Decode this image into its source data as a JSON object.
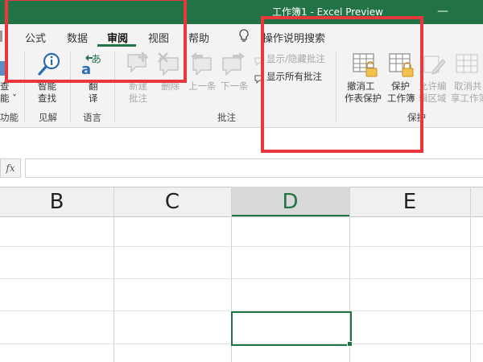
{
  "window": {
    "title": "工作簿1  -  Excel Preview",
    "minimize_glyph": "—"
  },
  "tabs": [
    {
      "label": "公式",
      "active": false
    },
    {
      "label": "数据",
      "active": false
    },
    {
      "label": "审阅",
      "active": true
    },
    {
      "label": "视图",
      "active": false
    },
    {
      "label": "帮助",
      "active": false
    }
  ],
  "tell_me": {
    "icon": "lightbulb-icon",
    "label": "操作说明搜索"
  },
  "ribbon": {
    "partial_left": {
      "fragment1": "查",
      "fragment2": "能 ˅",
      "group_fragment": "功能"
    },
    "smart_lookup": {
      "icon": "smart-lookup-icon",
      "line1": "智能",
      "line2": "查找"
    },
    "insights_group": "见解",
    "translate": {
      "icon": "translate-icon",
      "line1": "翻",
      "line2": "译"
    },
    "language_group": "语言",
    "new_comment": {
      "icon": "new-comment-icon",
      "line1": "新建",
      "line2": "批注"
    },
    "delete_comment": {
      "icon": "delete-comment-icon",
      "label": "删除"
    },
    "prev_comment": {
      "icon": "previous-comment-icon",
      "label": "上一条"
    },
    "next_comment": {
      "icon": "next-comment-icon",
      "label": "下一条"
    },
    "show_hide_comment": "显示/隐藏批注",
    "show_all_comments": "显示所有批注",
    "comments_group": "批注",
    "unprotect_sheet": {
      "icon": "unprotect-sheet-icon",
      "line1": "撤消工",
      "line2": "作表保护"
    },
    "protect_workbook": {
      "icon": "protect-workbook-icon",
      "line1": "保护",
      "line2": "工作簿"
    },
    "allow_edit_ranges": {
      "icon": "allow-edit-ranges-icon",
      "line1": "允许编",
      "line2": "辑区域"
    },
    "unshare": {
      "icon": "unshare-workbook-icon",
      "line1": "取消共",
      "line2": "享工作簿"
    },
    "protect_group": "保护"
  },
  "formula_bar": {
    "fx": "fx",
    "value": ""
  },
  "columns": [
    {
      "label": "B",
      "selected": false
    },
    {
      "label": "C",
      "selected": false
    },
    {
      "label": "D",
      "selected": true
    },
    {
      "label": "E",
      "selected": false
    }
  ],
  "colors": {
    "accent": "#217346",
    "annotation": "#e8383d"
  }
}
